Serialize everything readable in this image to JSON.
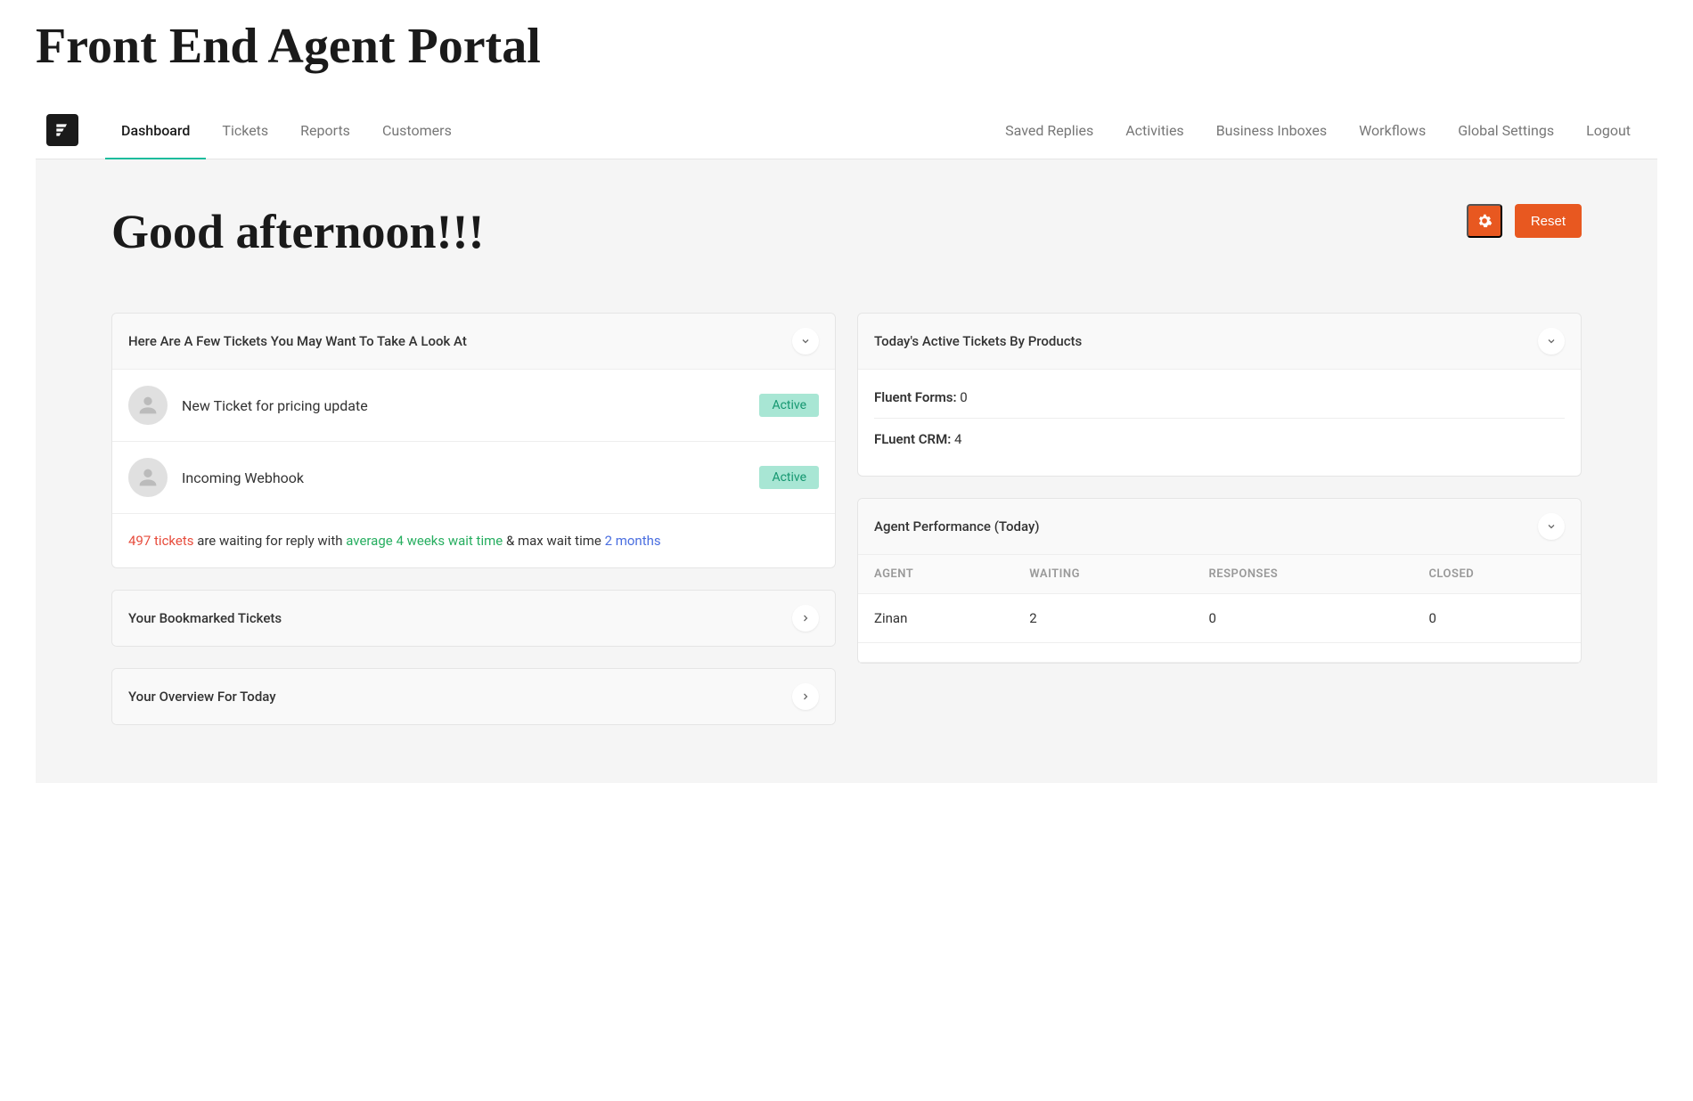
{
  "page_title": "Front End Agent Portal",
  "nav_left": [
    {
      "label": "Dashboard",
      "active": true
    },
    {
      "label": "Tickets"
    },
    {
      "label": "Reports"
    },
    {
      "label": "Customers"
    }
  ],
  "nav_right": [
    {
      "label": "Saved Replies"
    },
    {
      "label": "Activities"
    },
    {
      "label": "Business Inboxes"
    },
    {
      "label": "Workflows"
    },
    {
      "label": "Global Settings"
    },
    {
      "label": "Logout"
    }
  ],
  "greeting": "Good afternoon!!!",
  "reset_label": "Reset",
  "cards": {
    "tickets_look": {
      "title": "Here Are A Few Tickets You May Want To Take A Look At",
      "items": [
        {
          "title": "New Ticket for pricing update",
          "badge": "Active"
        },
        {
          "title": "Incoming Webhook",
          "badge": "Active"
        }
      ],
      "summary": {
        "count_text": "497 tickets",
        "mid1": " are waiting for reply with ",
        "avg_text": "average 4 weeks wait time",
        "mid2": " & max wait time ",
        "max_text": "2 months"
      }
    },
    "bookmarked": {
      "title": "Your Bookmarked Tickets"
    },
    "overview": {
      "title": "Your Overview For Today"
    },
    "products": {
      "title": "Today's Active Tickets By Products",
      "items": [
        {
          "name": "Fluent Forms:",
          "value": "0"
        },
        {
          "name": "FLuent CRM:",
          "value": "4"
        }
      ]
    },
    "performance": {
      "title": "Agent Performance (Today)",
      "headers": [
        "AGENT",
        "WAITING",
        "RESPONSES",
        "CLOSED"
      ],
      "rows": [
        {
          "agent": "Zinan",
          "waiting": "2",
          "responses": "0",
          "closed": "0"
        }
      ]
    }
  }
}
